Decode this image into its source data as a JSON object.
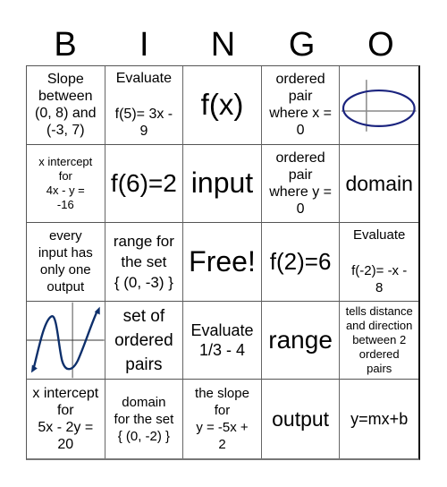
{
  "header": {
    "letters": [
      "B",
      "I",
      "N",
      "G",
      "O"
    ]
  },
  "cells": [
    {
      "text": "Slope\nbetween\n(0, 8) and\n(-3, 7)"
    },
    {
      "title": "Evaluate",
      "expr": "f(5)= 3x -\n9"
    },
    {
      "text": "f(x)"
    },
    {
      "text": "ordered\npair\nwhere x =\n0"
    },
    {
      "image": "ellipse-graph-icon"
    },
    {
      "text": "x intercept\nfor\n4x - y =\n-16"
    },
    {
      "text": "f(6)=2"
    },
    {
      "text": "input"
    },
    {
      "text": "ordered\npair\nwhere y =\n0"
    },
    {
      "text": "domain"
    },
    {
      "text": "every\ninput has\nonly one\noutput"
    },
    {
      "text": "range for\nthe set\n{ (0, -3) }"
    },
    {
      "text": "Free!"
    },
    {
      "text": "f(2)=6"
    },
    {
      "title": "Evaluate",
      "expr": "f(-2)= -x -\n8"
    },
    {
      "image": "cubic-graph-icon"
    },
    {
      "text": "set of\nordered\npairs"
    },
    {
      "text": "Evaluate\n1/3 - 4"
    },
    {
      "text": "range"
    },
    {
      "text": "tells distance\nand direction\nbetween 2\nordered\npairs"
    },
    {
      "text": "x intercept\nfor\n5x - 2y =\n20"
    },
    {
      "text": "domain\nfor the set\n{ (0, -2) }"
    },
    {
      "text": "the slope\nfor\ny = -5x +\n2"
    },
    {
      "text": "output"
    },
    {
      "text": "y=mx+b"
    }
  ],
  "colors": {
    "graph_curve": "#1a237e",
    "axis": "#888888"
  }
}
